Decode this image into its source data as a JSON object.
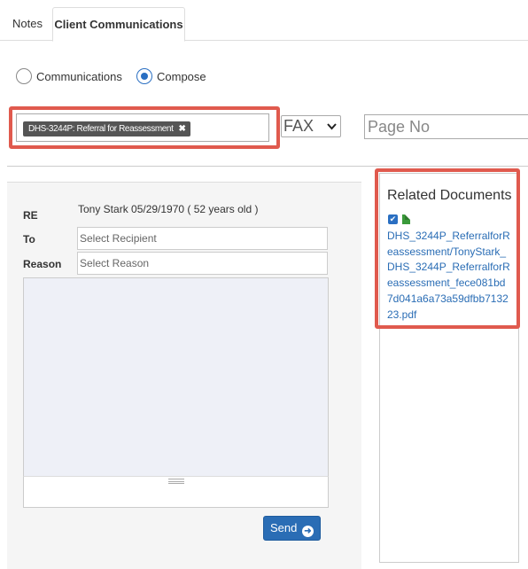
{
  "tabs": [
    {
      "label": "Notes",
      "active": false
    },
    {
      "label": "Client Communications",
      "active": true
    }
  ],
  "mode": {
    "options": [
      {
        "label": "Communications",
        "selected": false
      },
      {
        "label": "Compose",
        "selected": true
      }
    ]
  },
  "document_select": {
    "tag_label": "DHS-3244P: Referral for Reassessment",
    "remove_glyph": "✖"
  },
  "delivery": {
    "method": "FAX",
    "page_no_placeholder": "Page No"
  },
  "compose": {
    "re_label": "RE",
    "re_value": "Tony Stark 05/29/1970 ( 52 years old )",
    "to_label": "To",
    "to_placeholder": "Select Recipient",
    "reason_label": "Reason",
    "reason_placeholder": "Select Reason",
    "send_label": "Send"
  },
  "related_documents": {
    "title": "Related Documents",
    "items": [
      {
        "checked": true,
        "filename": "DHS_3244P_ReferralforReassessment/TonyStark_DHS_3244P_ReferralforReassessment_fece081bd7d041a6a73a59dfbb713223.pdf"
      }
    ]
  },
  "colors": {
    "highlight": "#e05a4e",
    "accent": "#2a6db5",
    "file_icon": "#3a9a3a"
  }
}
